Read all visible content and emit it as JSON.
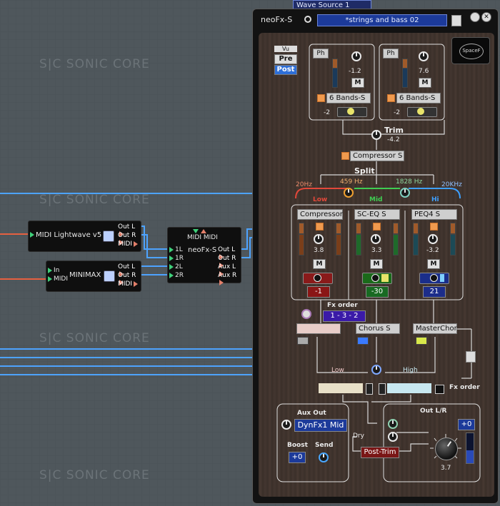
{
  "background": {
    "watermark": "S|C SONIC CORE",
    "top_strip": "Wave Source 1",
    "colors": {
      "canvas": "#4f575c",
      "cable_blue": "#4da3ff",
      "cable_red": "#e66040"
    }
  },
  "modules": {
    "lightwave": {
      "in_label": "MIDI",
      "name": "Lightwave v5",
      "outputs": [
        "Out L",
        "Out R",
        "MIDI"
      ]
    },
    "minimax": {
      "inputs": [
        "In",
        "MIDI"
      ],
      "name": "MINIMAX",
      "outputs": [
        "Out L",
        "Out R",
        "MIDI"
      ]
    },
    "neofx_node": {
      "top_label": "MIDI MIDI",
      "name": "neoFx-S",
      "inputs": [
        "1L",
        "1R",
        "2L",
        "2R"
      ],
      "outputs": [
        "Out L",
        "Out R",
        "Aux L",
        "Aux R"
      ]
    }
  },
  "plugin": {
    "title": "neoFx-S",
    "preset": "*strings and bass 02",
    "logo": "SpaceF",
    "meter_mode": {
      "label": "Vu",
      "pre": "Pre",
      "post": "Post"
    },
    "input_a": {
      "phase": "Ph",
      "gain": "-1.2",
      "mute": "M",
      "eq": "6 Bands-S",
      "balance": "-2"
    },
    "input_b": {
      "phase": "Ph",
      "gain": "7.6",
      "mute": "M",
      "eq": "6 Bands-S",
      "balance": "-2"
    },
    "trim": {
      "label": "Trim",
      "value": "-4.2"
    },
    "compressor": "Compressor S",
    "split": {
      "label": "Split",
      "low_freq": "20Hz",
      "x1": "459 Hz",
      "x2": "1828 Hz",
      "high_freq": "20KHz"
    },
    "bands": [
      {
        "name": "Low",
        "effect": "Compressor",
        "value": "3.8",
        "mute": "M",
        "level": "-1"
      },
      {
        "name": "Mid",
        "effect": "SC-EQ S",
        "value": "3.3",
        "mute": "M",
        "level": "-30"
      },
      {
        "name": "Hi",
        "effect": "PEQ4 S",
        "value": "-3.2",
        "mute": "M",
        "level": "21"
      }
    ],
    "fx_order": {
      "label": "Fx order",
      "value": "1 - 3 - 2"
    },
    "send_fx": [
      "",
      "Chorus S",
      "MasterChor"
    ],
    "crossfade": {
      "low": "Low",
      "high": "High",
      "label": "Fx order"
    },
    "aux_out": {
      "label": "Aux Out",
      "target": "DynFx1 Mid",
      "boost_label": "Boost",
      "boost_value": "+0",
      "send_label": "Send"
    },
    "out_lr": {
      "label": "Out L/R",
      "dry": "Dry",
      "post_trim": "Post-Trim",
      "value": "+0",
      "knob_value": "3.7"
    }
  }
}
